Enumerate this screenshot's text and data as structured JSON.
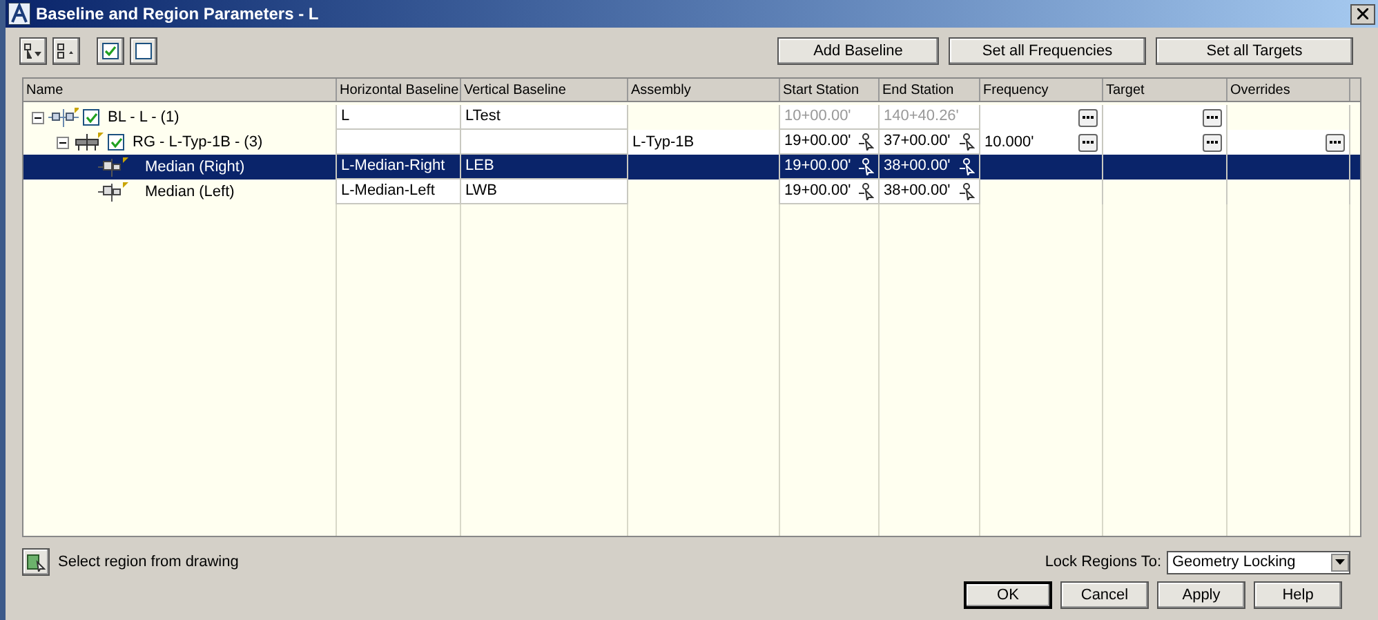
{
  "window": {
    "title": "Baseline and Region Parameters - L"
  },
  "toolbar": {
    "buttons": [
      "Add Baseline",
      "Set all Frequencies",
      "Set all Targets"
    ]
  },
  "table": {
    "columns": [
      "Name",
      "Horizontal Baseline",
      "Vertical Baseline",
      "Assembly",
      "Start Station",
      "End Station",
      "Frequency",
      "Target",
      "Overrides"
    ],
    "rows": [
      {
        "kind": "baseline",
        "name": "BL - L - (1)",
        "checked": true,
        "expanded": true,
        "selected": false,
        "horizontal_baseline": "L",
        "vertical_baseline": "LTest",
        "start_station": "10+00.00'",
        "end_station": "140+40.26'",
        "stations_disabled": true,
        "frequency_button": true,
        "target_button": true,
        "overrides_button": false,
        "children": [
          {
            "kind": "region",
            "name": "RG - L-Typ-1B - (3)",
            "checked": true,
            "expanded": true,
            "selected": false,
            "assembly": "L-Typ-1B",
            "start_station": "19+00.00'",
            "end_station": "37+00.00'",
            "stations_disabled": false,
            "frequency": "10.000'",
            "frequency_button": true,
            "target_button": true,
            "overrides_button": true,
            "children": [
              {
                "kind": "offset",
                "name": "Median (Right)",
                "selected": true,
                "horizontal_baseline": "L-Median-Right",
                "vertical_baseline": "LEB",
                "start_station": "19+00.00'",
                "end_station": "38+00.00'",
                "stations_disabled": false,
                "frequency_button": false,
                "target_button": false,
                "overrides_button": false
              },
              {
                "kind": "offset",
                "name": "Median (Left)",
                "selected": false,
                "horizontal_baseline": "L-Median-Left",
                "vertical_baseline": "LWB",
                "start_station": "19+00.00'",
                "end_station": "38+00.00'",
                "stations_disabled": false,
                "frequency_button": false,
                "target_button": false,
                "overrides_button": false
              }
            ]
          }
        ]
      }
    ]
  },
  "footer": {
    "select_region": "Select region from drawing",
    "lock_label": "Lock Regions To:",
    "lock_value": "Geometry Locking",
    "buttons": [
      "OK",
      "Cancel",
      "Apply",
      "Help"
    ]
  }
}
